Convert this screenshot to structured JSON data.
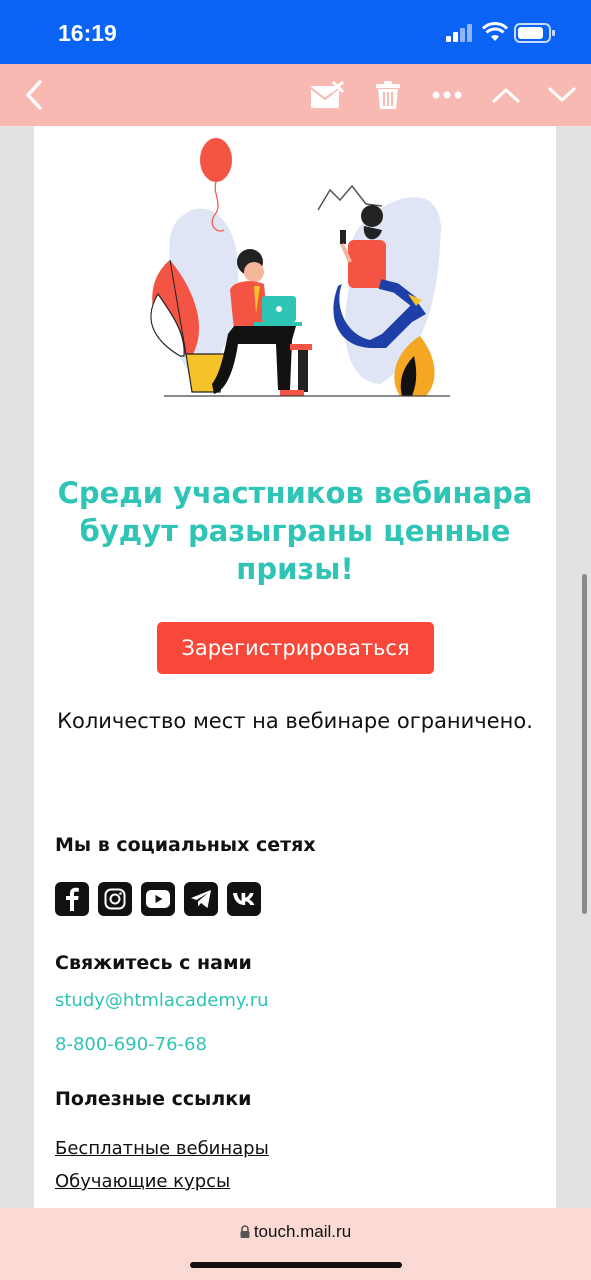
{
  "status_bar": {
    "time": "16:19"
  },
  "toolbar": {
    "back_icon": "chevron-left-icon",
    "actions": [
      "mark-unread-icon",
      "trash-icon",
      "more-icon",
      "chevron-up-icon",
      "chevron-down-icon"
    ]
  },
  "email": {
    "headline": "Среди участников вебинара будут разыграны ценные призы!",
    "cta_label": "Зарегистрироваться",
    "limited_text": "Количество мест на вебинаре ограничено.",
    "socials_title": "Мы в социальных сетях",
    "socials": [
      "facebook-icon",
      "instagram-icon",
      "youtube-icon",
      "telegram-icon",
      "vk-icon"
    ],
    "contact_title": "Свяжитесь с нами",
    "email_address": "study@htmlacademy.ru",
    "phone": "8-800-690-76-68",
    "links_title": "Полезные ссылки",
    "links": [
      "Бесплатные вебинары",
      "Обучающие курсы"
    ]
  },
  "url_bar": {
    "url": "touch.mail.ru"
  },
  "colors": {
    "accent": "#2ec4b6",
    "cta": "#f8483a",
    "toolbar": "#f9b9b3",
    "status_bar": "#0a63f5"
  }
}
